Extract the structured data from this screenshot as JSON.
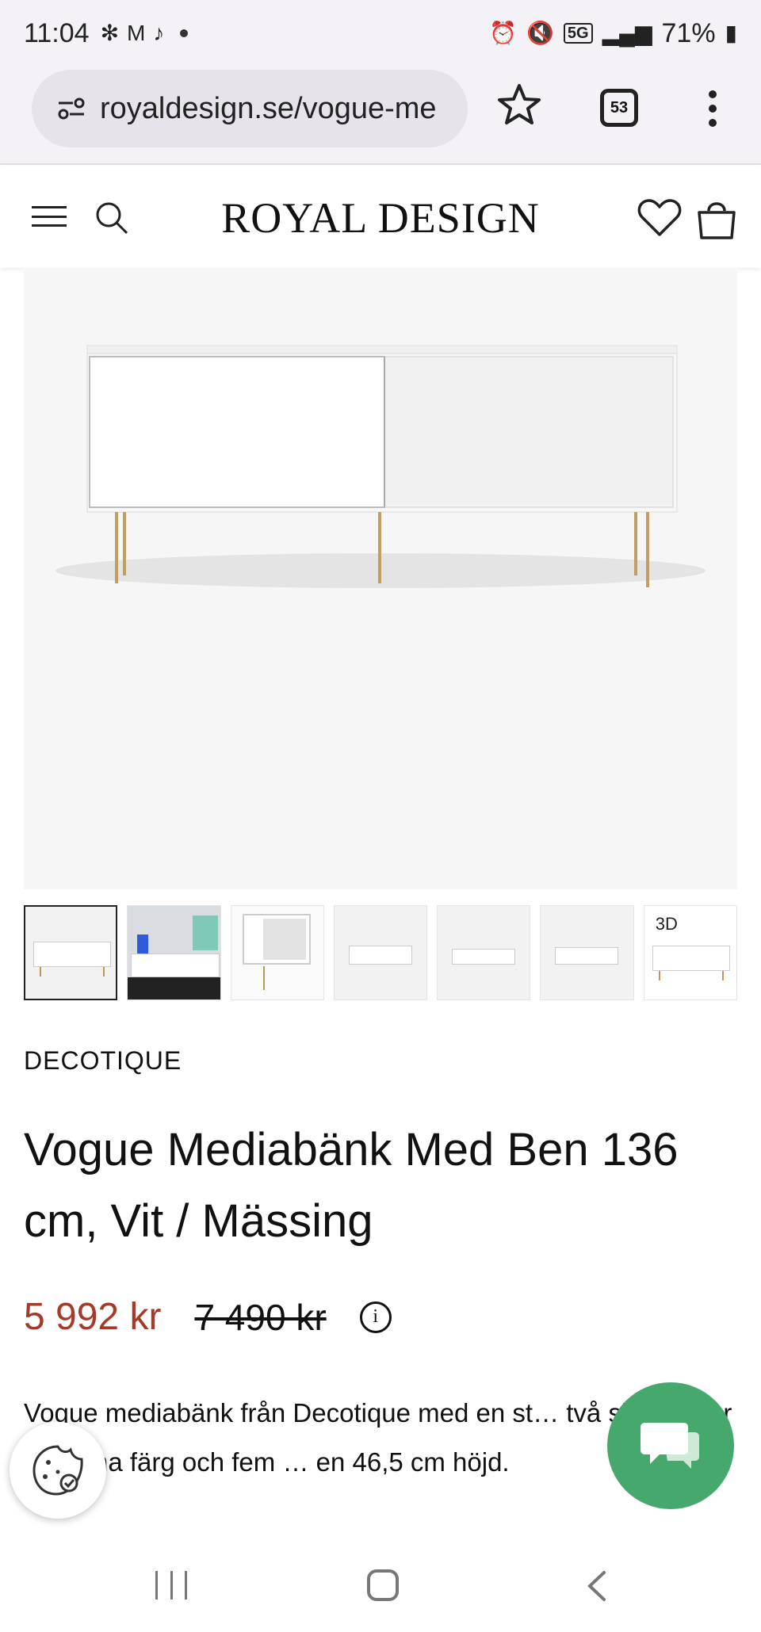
{
  "status_bar": {
    "time": "11:04",
    "battery": "71%",
    "network": "5G"
  },
  "browser": {
    "url": "royaldesign.se/vogue-me",
    "tab_count": "53"
  },
  "site": {
    "logo": "ROYAL DESIGN"
  },
  "gallery": {
    "badge_3d": "3D"
  },
  "product": {
    "brand": "DECOTIQUE",
    "title": "Vogue Mediabänk Med Ben 136 cm, Vit / Mässing",
    "price": "5 992 kr",
    "original_price": "7 490 kr",
    "info_icon": "i",
    "description": "Vogue mediabänk från Decotique med en st… två skjutdörrar i samma färg och fem … en 46,5 cm höjd."
  },
  "colors": {
    "price_red": "#a33a2a",
    "chat_green": "#47a86e"
  }
}
